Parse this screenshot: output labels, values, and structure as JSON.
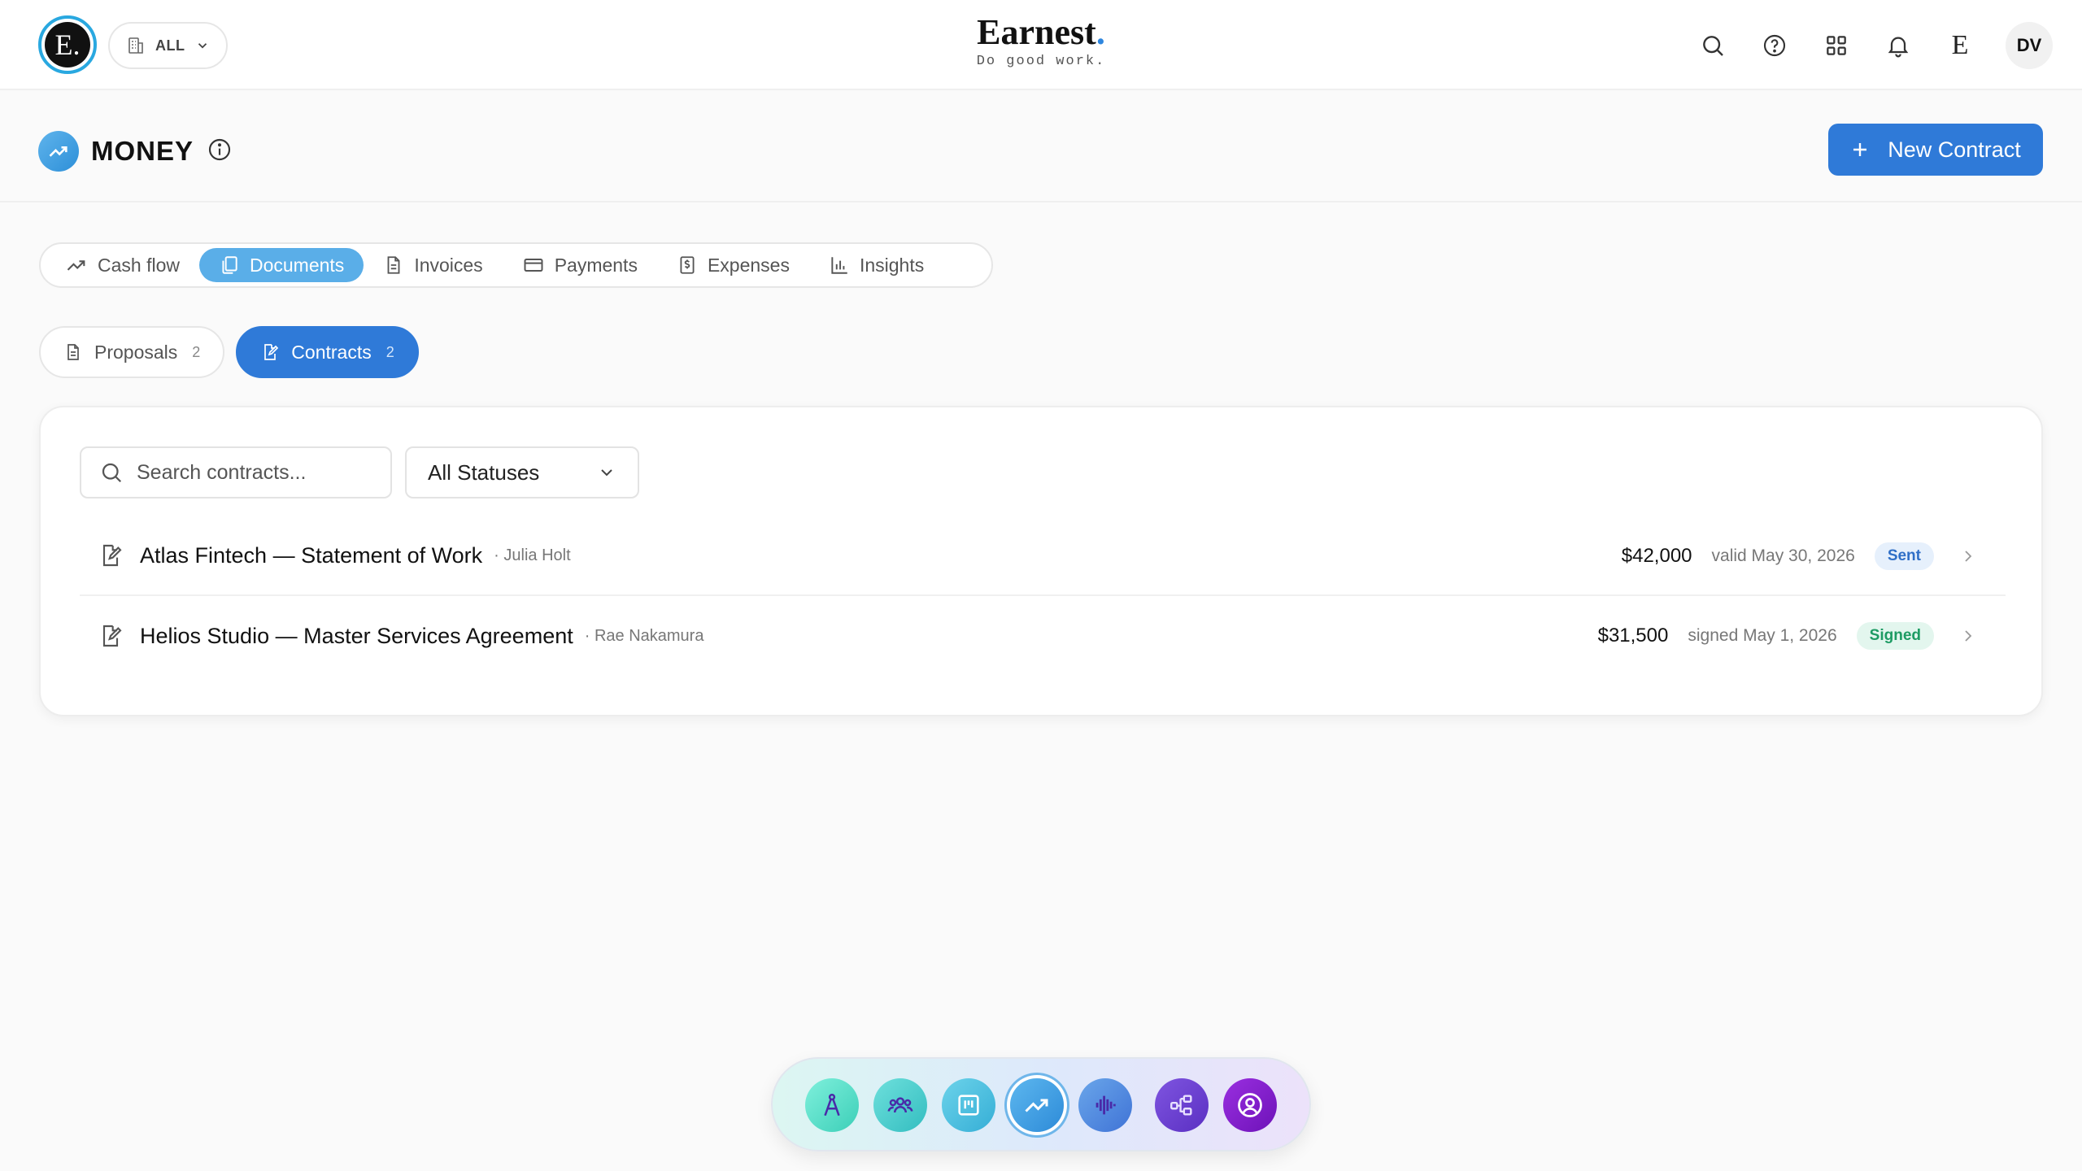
{
  "topbar": {
    "logo_letter": "E.",
    "workspace_label": "ALL",
    "brand_name": "Earnest",
    "brand_dot": ".",
    "tagline": "Do good work.",
    "e_mark": "E",
    "avatar_initials": "DV"
  },
  "header": {
    "title": "MONEY",
    "new_contract_label": "New Contract"
  },
  "tabs": [
    {
      "label": "Cash flow",
      "icon": "trend-up-icon",
      "active": false
    },
    {
      "label": "Documents",
      "icon": "documents-icon",
      "active": true
    },
    {
      "label": "Invoices",
      "icon": "invoice-icon",
      "active": false
    },
    {
      "label": "Payments",
      "icon": "card-icon",
      "active": false
    },
    {
      "label": "Expenses",
      "icon": "receipt-icon",
      "active": false
    },
    {
      "label": "Insights",
      "icon": "bar-chart-icon",
      "active": false
    }
  ],
  "subtabs": [
    {
      "label": "Proposals",
      "count": "2",
      "active": false
    },
    {
      "label": "Contracts",
      "count": "2",
      "active": true
    }
  ],
  "filters": {
    "search_placeholder": "Search contracts...",
    "status_selected": "All Statuses"
  },
  "contracts": [
    {
      "title": "Atlas Fintech — Statement of Work",
      "client": "Julia Holt",
      "amount": "$42,000",
      "date_text": "valid May 30, 2026",
      "status": "Sent"
    },
    {
      "title": "Helios Studio — Master Services Agreement",
      "client": "Rae Nakamura",
      "amount": "$31,500",
      "date_text": "signed May 1, 2026",
      "status": "Signed"
    }
  ],
  "dock": [
    {
      "icon": "compass-icon",
      "color": "#4fd8c4"
    },
    {
      "icon": "team-icon",
      "color": "#40c9c9"
    },
    {
      "icon": "board-icon",
      "color": "#3db8d8"
    },
    {
      "icon": "money-trend-icon",
      "color": "#3b97de",
      "current": true
    },
    {
      "icon": "voice-wave-icon",
      "color": "#4a7fdc"
    },
    {
      "icon": "workflow-icon",
      "color": "#6a3fd2"
    },
    {
      "icon": "user-circle-icon",
      "color": "#7d1fc4"
    }
  ],
  "colors": {
    "accent": "#2f7ad8",
    "tab_active": "#5aaee8",
    "sent_badge": "#2f6fc7",
    "signed_badge": "#1d9b63"
  }
}
